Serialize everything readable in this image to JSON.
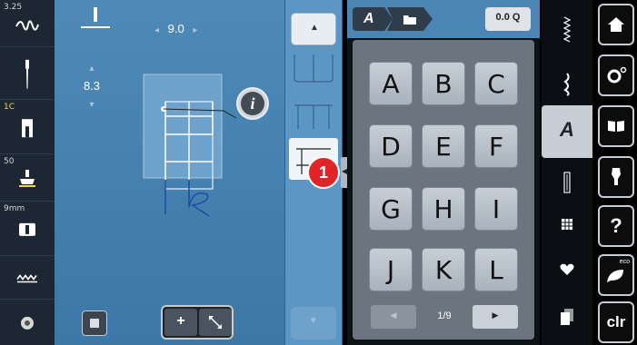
{
  "left_column": {
    "tension_value": "3.25",
    "thread_code": "1C",
    "presser_pressure": "50",
    "needle_plate": "9mm"
  },
  "stitch_controls": {
    "width_value": "9.0",
    "length_value": "8.3"
  },
  "alphabet": {
    "font_badge": "A",
    "zoom_label": "0.0 Q",
    "letters": [
      "A",
      "B",
      "C",
      "D",
      "E",
      "F",
      "G",
      "H",
      "I",
      "J",
      "K",
      "L"
    ],
    "page_indicator": "1/9"
  },
  "callout": "1",
  "info_label": "i",
  "nav": {
    "clear_label": "clr",
    "eco_label": "eco"
  },
  "colors": {
    "main_blue": "#4e8ab8",
    "callout_red": "#e0252a",
    "key_grey": "#b7bfc8",
    "dark_panel": "#0e1318"
  }
}
